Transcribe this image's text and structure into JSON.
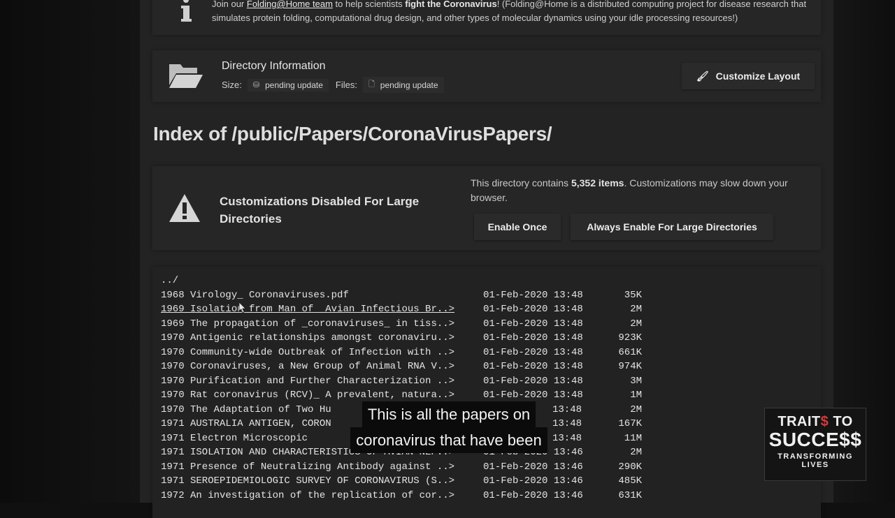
{
  "info": {
    "prefix": "Join our ",
    "link": "Folding@Home team",
    "middle": " to help scientists ",
    "bold": "fight the Coronavirus",
    "suffix": "! (Folding@Home is a distributed computing project for disease research that simulates protein folding, computational drug design, and other types of molecular dynamics using your idle processing resources!)"
  },
  "directory": {
    "title": "Directory Information",
    "size_label": "Size:",
    "size_value": "pending update",
    "files_label": "Files:",
    "files_value": "pending update",
    "customize_label": "Customize Layout"
  },
  "index_title": "Index of /public/Papers/CoronaVirusPapers/",
  "warning": {
    "title": "Customizations Disabled For Large Directories",
    "desc_prefix": "This directory contains ",
    "desc_count": "5,352 items",
    "desc_suffix": ". Customizations may slow down your browser.",
    "enable_once": "Enable Once",
    "always_enable": "Always Enable For Large Directories"
  },
  "listing": {
    "parent": "../",
    "rows": [
      {
        "name": "1968 Virology_ Coronaviruses.pdf",
        "date": "01-Feb-2020 13:48",
        "size": "35K"
      },
      {
        "name": "1969 Isolation from Man of _Avian Infectious Br..>",
        "date": "01-Feb-2020 13:48",
        "size": "2M"
      },
      {
        "name": "1969 The propagation of _coronaviruses_ in tiss..>",
        "date": "01-Feb-2020 13:48",
        "size": "2M"
      },
      {
        "name": "1970 Antigenic relationships amongst coronaviru..>",
        "date": "01-Feb-2020 13:48",
        "size": "923K"
      },
      {
        "name": "1970 Community-wide Outbreak of Infection with ..>",
        "date": "01-Feb-2020 13:48",
        "size": "661K"
      },
      {
        "name": "1970 Coronaviruses, a New Group of Animal RNA V..>",
        "date": "01-Feb-2020 13:48",
        "size": "974K"
      },
      {
        "name": "1970 Purification and Further Characterization ..>",
        "date": "01-Feb-2020 13:48",
        "size": "3M"
      },
      {
        "name": "1970 Rat coronavirus (RCV)_ A prevalent, natura..>",
        "date": "01-Feb-2020 13:48",
        "size": "1M"
      },
      {
        "name": "1970 The Adaptation of Two Hu",
        "date": "13:48",
        "size": "2M"
      },
      {
        "name": "1971 AUSTRALIA ANTIGEN, CORON",
        "date": "13:48",
        "size": "167K"
      },
      {
        "name": "1971 Electron Microscopic",
        "date": "13:48",
        "size": "11M"
      },
      {
        "name": "1971 ISOLATION AND CHARACTERISTICS OF AVIAN NEP..>",
        "date": "01-Feb-2020 13:46",
        "size": "2M"
      },
      {
        "name": "1971 Presence of Neutralizing Antibody against ..>",
        "date": "01-Feb-2020 13:46",
        "size": "290K"
      },
      {
        "name": "1971 SEROEPIDEMIOLOGIC SURVEY OF CORONAVIRUS (S..>",
        "date": "01-Feb-2020 13:46",
        "size": "485K"
      },
      {
        "name": "1972 An investigation of the replication of cor..>",
        "date": "01-Feb-2020 13:46",
        "size": "631K"
      }
    ]
  },
  "caption": {
    "line1": "This is all the papers on",
    "line2": "coronavirus that have been"
  },
  "logo": {
    "line1a": "TRAIT",
    "line1b": "$",
    "line1c": " TO",
    "line2": "SUCCE$$",
    "line3": "TRANSFORMING",
    "line4": "LIVES"
  }
}
